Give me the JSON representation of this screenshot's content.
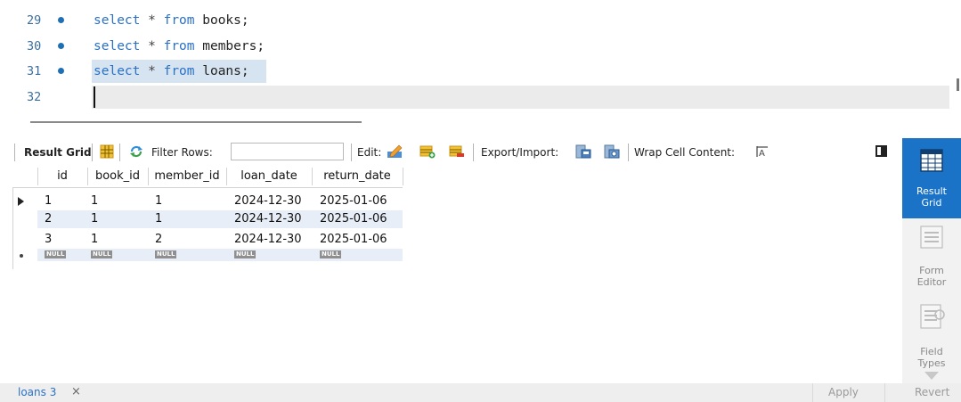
{
  "editor": {
    "lines": [
      {
        "number": "29",
        "kw1": "select",
        "star": " * ",
        "kw2": "from",
        "rest": " books;"
      },
      {
        "number": "30",
        "kw1": "select",
        "star": " * ",
        "kw2": "from",
        "rest": " members;"
      },
      {
        "number": "31",
        "kw1": "select",
        "star": " * ",
        "kw2": "from",
        "rest": " loans;"
      },
      {
        "number": "32"
      }
    ]
  },
  "toolbar": {
    "result_grid": "Result Grid",
    "filter_rows": "Filter Rows:",
    "filter_value": "",
    "edit": "Edit:",
    "export_import": "Export/Import:",
    "wrap": "Wrap Cell Content:"
  },
  "grid": {
    "columns": [
      "id",
      "book_id",
      "member_id",
      "loan_date",
      "return_date"
    ],
    "rows": [
      [
        "1",
        "1",
        "1",
        "2024-12-30",
        "2025-01-06"
      ],
      [
        "2",
        "1",
        "1",
        "2024-12-30",
        "2025-01-06"
      ],
      [
        "3",
        "1",
        "2",
        "2024-12-30",
        "2025-01-06"
      ]
    ],
    "null_label": "NULL"
  },
  "side_panel": {
    "result_grid": [
      "Result",
      "Grid"
    ],
    "form_editor": [
      "Form",
      "Editor"
    ],
    "field_types": [
      "Field",
      "Types"
    ]
  },
  "bottom": {
    "tab": "loans 3",
    "close": "×",
    "apply": "Apply",
    "revert": "Revert"
  },
  "colors": {
    "keyword": "#2a71c7",
    "accent": "#1a73c7",
    "stripe": "#e8eef7",
    "selection": "#d6e4f2"
  }
}
